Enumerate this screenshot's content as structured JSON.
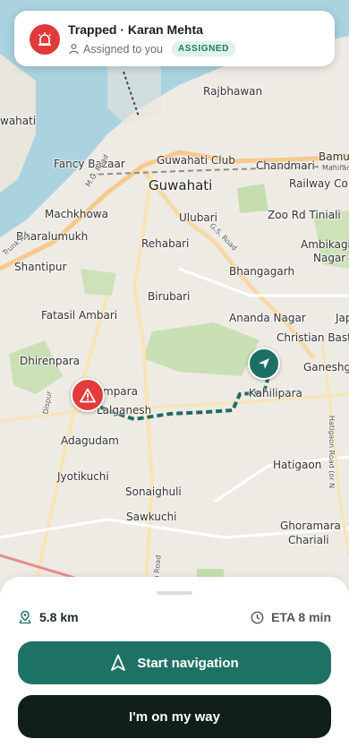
{
  "alert": {
    "title": "Trapped · Karan Mehta",
    "assigned_text": "Assigned to you",
    "badge": "ASSIGNED",
    "icon": "siren-icon",
    "accent": "#e03a3a"
  },
  "map": {
    "labels": {
      "rajbhawan": "Rajbhawan",
      "wahati": "wahati",
      "guwahati_club": "Guwahati Club",
      "chandmari": "Chandmari",
      "bamu": "Bamu",
      "manram": "Maniram D",
      "railway_colony": "Railway Colo",
      "fancy_bazaar": "Fancy Bazaar",
      "guwahati": "Guwahati",
      "machkhowa": "Machkhowa",
      "ulubari": "Ulubari",
      "zoo_rd": "Zoo Rd Tiniali",
      "bharalumukh": "Bharalumukh",
      "rehabari": "Rehabari",
      "ambikagi": "Ambikagi",
      "nagar": "Nagar",
      "shantipur": "Shantipur",
      "bhangagarh": "Bhangagarh",
      "birubari": "Birubari",
      "fatasil": "Fatasil Ambari",
      "ananda": "Ananda Nagar",
      "jap": "Jap",
      "christian": "Christian Basti",
      "dhirenpara": "Dhirenpara",
      "ganeshg": "Ganeshg",
      "ampara": "mpara",
      "kahilipara": "Kahilipara",
      "lalganesh": "Lalganesh",
      "adagudam": "Adagudam",
      "jyotikuchi": "Jyotikuchi",
      "hatigaon": "Hatigaon",
      "sonaighuli": "Sonaighuli",
      "sawkuchi": "Sawkuchi",
      "ghoramara": "Ghoramara",
      "chariali": "Chariali",
      "mg_road": "M.G. Road",
      "gs_road": "G.S. Road",
      "lokhra_road": "Lokhra Road",
      "trunk_rd": "Trunk Rd",
      "dispur": "Dispur",
      "hatigaon_road": "Hatigaon Road (or N"
    }
  },
  "sheet": {
    "distance": "5.8 km",
    "eta": "ETA 8 min",
    "start_nav_label": "Start navigation",
    "on_way_label": "I'm on my way"
  },
  "colors": {
    "primary": "#1e7265",
    "dark": "#101f1b",
    "incident": "#e23c3c",
    "route": "#1f6b5f"
  }
}
